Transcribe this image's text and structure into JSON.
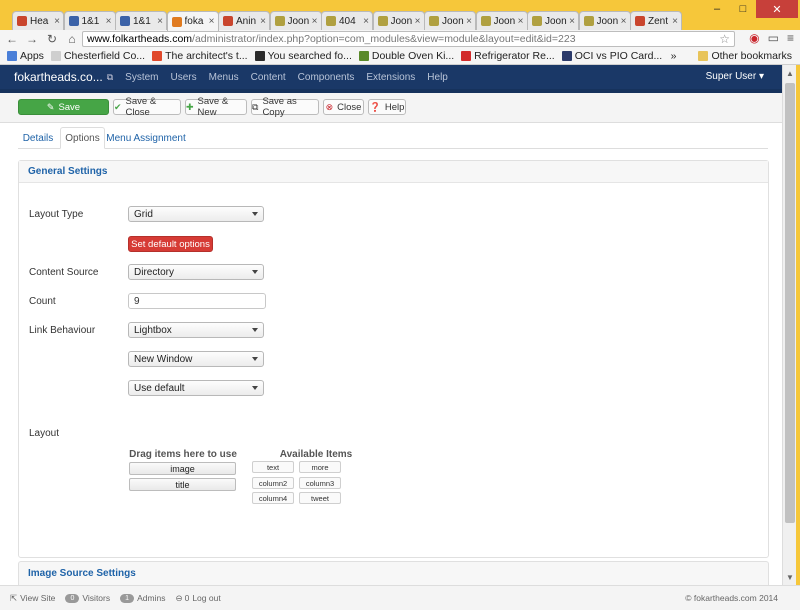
{
  "browser": {
    "tabs": [
      {
        "label": "Hea",
        "fav": "#c9452d"
      },
      {
        "label": "1&1",
        "fav": "#3b62a8"
      },
      {
        "label": "1&1",
        "fav": "#3b62a8"
      },
      {
        "label": "foka",
        "fav": "#e07b20",
        "active": true
      },
      {
        "label": "Anin",
        "fav": "#c9452d"
      },
      {
        "label": "Joon",
        "fav": "#b0a040"
      },
      {
        "label": "404",
        "fav": "#b0a040"
      },
      {
        "label": "Joon",
        "fav": "#b0a040"
      },
      {
        "label": "Joon",
        "fav": "#b0a040"
      },
      {
        "label": "Joon",
        "fav": "#b0a040"
      },
      {
        "label": "Joon",
        "fav": "#b0a040"
      },
      {
        "label": "Joon",
        "fav": "#b0a040"
      },
      {
        "label": "Zent",
        "fav": "#c9452d"
      }
    ],
    "url_host": "www.folkartheads.com",
    "url_path": "/administrator/index.php?option=com_modules&view=module&layout=edit&id=223",
    "bookmarks": [
      {
        "label": "Apps",
        "color": "#4a7fd8"
      },
      {
        "label": "Chesterfield Co...",
        "color": "#cfcfcf"
      },
      {
        "label": "The architect's t...",
        "color": "#e0482b"
      },
      {
        "label": "You searched fo...",
        "color": "#2b2b2b"
      },
      {
        "label": "Double Oven Ki...",
        "color": "#5a8a2a"
      },
      {
        "label": "Refrigerator Re...",
        "color": "#d22b2b"
      },
      {
        "label": "OCI vs PIO Card...",
        "color": "#2b3a6a"
      }
    ],
    "bookmarks_more": "»",
    "other_bookmarks": "Other bookmarks"
  },
  "admin": {
    "brand": "fokartheads.co...",
    "menu": [
      "System",
      "Users",
      "Menus",
      "Content",
      "Components",
      "Extensions",
      "Help"
    ],
    "user": "Super User ▾",
    "toolbar": {
      "save": "Save",
      "save_close": "Save & Close",
      "save_new": "Save & New",
      "save_copy": "Save as Copy",
      "close": "Close",
      "help": "Help"
    },
    "tabs": [
      "Details",
      "Options",
      "Menu Assignment"
    ],
    "general_settings": "General Settings",
    "fields": {
      "layout_type_label": "Layout Type",
      "layout_type_value": "Grid",
      "set_default": "Set default options",
      "content_source_label": "Content Source",
      "content_source_value": "Directory",
      "count_label": "Count",
      "count_value": "9",
      "link_behaviour_label": "Link Behaviour",
      "link_behaviour_value": "Lightbox",
      "window_value": "New Window",
      "default_value": "Use default",
      "layout_label": "Layout"
    },
    "layout_builder": {
      "drag_title": "Drag items here to use",
      "used": [
        "image",
        "title"
      ],
      "available_title": "Available Items",
      "available": [
        "text",
        "more",
        "column2",
        "column3",
        "column4",
        "tweet"
      ]
    },
    "image_source_settings": "Image Source Settings",
    "footer": {
      "view_site": "View Site",
      "visitors_count": "0",
      "visitors": "Visitors",
      "admins_count": "1",
      "admins": "Admins",
      "logout_count": "0",
      "logout": "Log out",
      "copyright": "© fokartheads.com 2014"
    }
  }
}
